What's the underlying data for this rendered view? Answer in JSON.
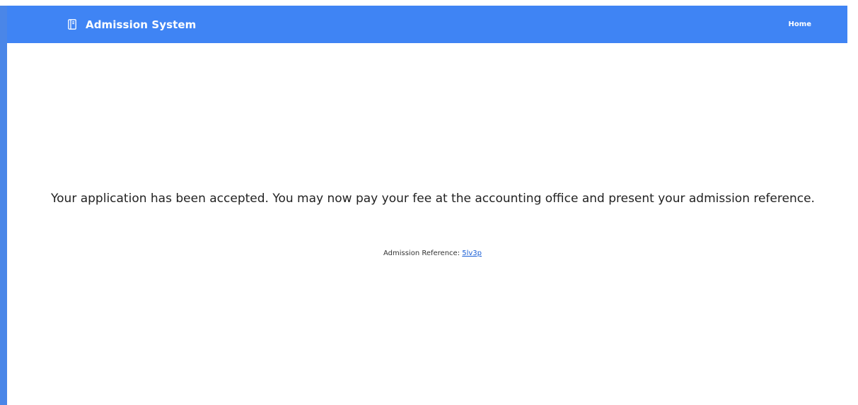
{
  "header": {
    "brand_icon": "book-icon",
    "title": "Admission System",
    "nav_home": "Home"
  },
  "main": {
    "message": "Your application has been accepted. You may now pay your fee at the accounting office and present your admission reference.",
    "reference_label": "Admission Reference:",
    "reference_value": "5lv3p"
  },
  "colors": {
    "navbar": "#3f84f4",
    "accent_edge": "#4a86e8",
    "link": "#1a5fd6",
    "text": "#222222"
  }
}
